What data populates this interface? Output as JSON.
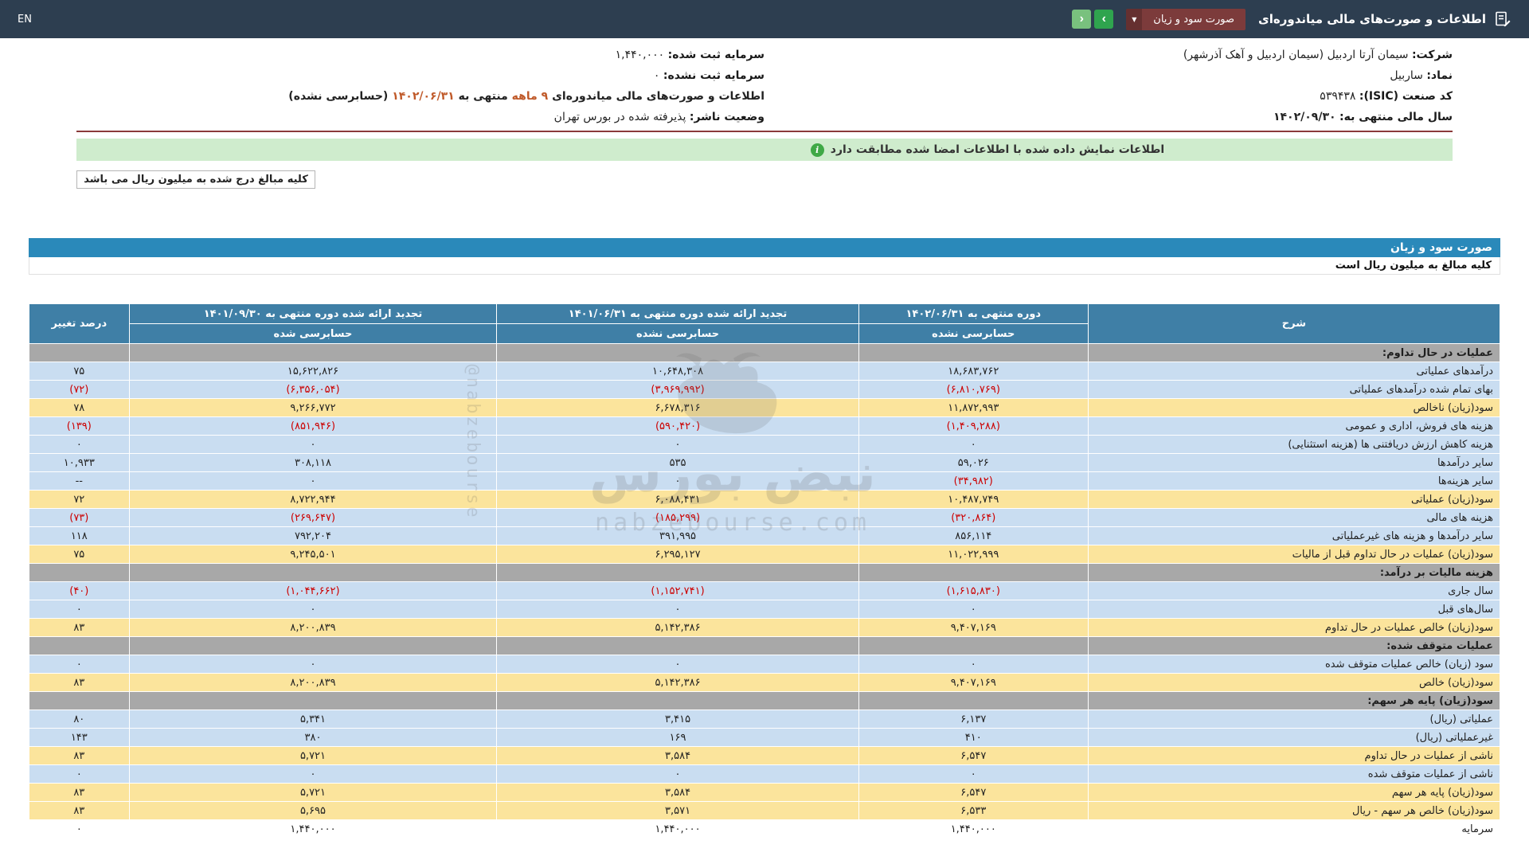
{
  "colors": {
    "topbar": "#2d3e50",
    "dropdown_maroon": "#7c3b3b",
    "nav_green": "#2fa44e",
    "banner_green": "#cfeccd",
    "statement_title_bar": "#2a89ba",
    "table_header": "#3f7fa6",
    "row_blue": "#c9ddf1",
    "row_yellow": "#fbe49c",
    "section_gray": "#a8a8a8",
    "negative_red": "#cc0000",
    "date_highlight": "#c05a2a"
  },
  "topbar": {
    "title": "اطلاعات و صورت‌های مالی میاندوره‌ای",
    "dropdown_value": "صورت سود و زیان",
    "lang_toggle": "EN"
  },
  "company_info": {
    "company_label": "شرکت:",
    "company_value": "سیمان آرتا اردبیل (سیمان اردبیل و آهک آذرشهر)",
    "symbol_label": "نماد:",
    "symbol_value": "ساربیل",
    "isic_label": "کد صنعت (ISIC):",
    "isic_value": "۵۳۹۴۳۸",
    "fiscal_year_label": "سال مالی منتهی به:",
    "fiscal_year_value": "۱۴۰۲/۰۹/۳۰",
    "registered_capital_label": "سرمایه ثبت شده:",
    "registered_capital_value": "۱,۴۴۰,۰۰۰",
    "unregistered_capital_label": "سرمایه ثبت نشده:",
    "unregistered_capital_value": "۰",
    "period_prefix": "اطلاعات و صورت‌های مالی میاندوره‌ای",
    "period_months": "۹ ماهه",
    "period_middle": "منتهی به",
    "period_date": "۱۴۰۲/۰۶/۳۱",
    "period_suffix": "(حسابرسی نشده)",
    "issuer_label": "وضعیت ناشر:",
    "issuer_value": "پذیرفته شده در بورس تهران"
  },
  "notices": {
    "signature_match": "اطلاعات نمایش داده شده با اطلاعات امضا شده مطابقت دارد",
    "amounts_unit_top": "کلیه مبالغ درج شده به میلیون ریال می باشد"
  },
  "statement": {
    "title": "صورت سود و زیان",
    "unit_note": "کلیه مبالغ به میلیون ریال است"
  },
  "table": {
    "headers": {
      "description": "شرح",
      "col1_title": "دوره منتهی به ۱۴۰۲/۰۶/۳۱",
      "col1_sub": "حسابرسی نشده",
      "col2_title": "تجدید ارائه شده دوره منتهی به ۱۴۰۱/۰۶/۳۱",
      "col2_sub": "حسابرسی نشده",
      "col3_title": "تجدید ارائه شده دوره منتهی به ۱۴۰۱/۰۹/۳۰",
      "col3_sub": "حسابرسی شده",
      "pct_change": "درصد تغییر"
    },
    "rows": [
      {
        "style": "section",
        "label": "عملیات در حال تداوم:",
        "c1": "",
        "c2": "",
        "c3": "",
        "pct": ""
      },
      {
        "style": "blue",
        "label": "درآمدهای عملیاتی",
        "c1": "۱۸,۶۸۳,۷۶۲",
        "c2": "۱۰,۶۴۸,۳۰۸",
        "c3": "۱۵,۶۲۲,۸۲۶",
        "pct": "۷۵"
      },
      {
        "style": "blue",
        "label": "بهای تمام شده درآمدهای عملیاتی",
        "c1": "(۶,۸۱۰,۷۶۹)",
        "c2": "(۳,۹۶۹,۹۹۲)",
        "c3": "(۶,۳۵۶,۰۵۴)",
        "pct": "(۷۲)"
      },
      {
        "style": "yellow",
        "label": "سود(زیان) ناخالص",
        "c1": "۱۱,۸۷۲,۹۹۳",
        "c2": "۶,۶۷۸,۳۱۶",
        "c3": "۹,۲۶۶,۷۷۲",
        "pct": "۷۸"
      },
      {
        "style": "blue",
        "label": "هزینه های فروش، اداری و عمومی",
        "c1": "(۱,۴۰۹,۲۸۸)",
        "c2": "(۵۹۰,۴۲۰)",
        "c3": "(۸۵۱,۹۴۶)",
        "pct": "(۱۳۹)"
      },
      {
        "style": "blue",
        "label": "هزینه کاهش ارزش دریافتنی ها (هزینه استثنایی)",
        "c1": "۰",
        "c2": "۰",
        "c3": "۰",
        "pct": "۰"
      },
      {
        "style": "blue",
        "label": "سایر درآمدها",
        "c1": "۵۹,۰۲۶",
        "c2": "۵۳۵",
        "c3": "۳۰۸,۱۱۸",
        "pct": "۱۰,۹۳۳"
      },
      {
        "style": "blue",
        "label": "سایر هزینه‌ها",
        "c1": "(۳۴,۹۸۲)",
        "c2": "۰",
        "c3": "۰",
        "pct": "--"
      },
      {
        "style": "yellow",
        "label": "سود(زیان) عملیاتی",
        "c1": "۱۰,۴۸۷,۷۴۹",
        "c2": "۶,۰۸۸,۴۳۱",
        "c3": "۸,۷۲۲,۹۴۴",
        "pct": "۷۲"
      },
      {
        "style": "blue",
        "label": "هزینه های مالی",
        "c1": "(۳۲۰,۸۶۴)",
        "c2": "(۱۸۵,۲۹۹)",
        "c3": "(۲۶۹,۶۴۷)",
        "pct": "(۷۳)"
      },
      {
        "style": "blue",
        "label": "سایر درآمدها و هزینه های غیرعملیاتی",
        "c1": "۸۵۶,۱۱۴",
        "c2": "۳۹۱,۹۹۵",
        "c3": "۷۹۲,۲۰۴",
        "pct": "۱۱۸"
      },
      {
        "style": "yellow",
        "label": "سود(زیان) عملیات در حال تداوم قبل از مالیات",
        "c1": "۱۱,۰۲۲,۹۹۹",
        "c2": "۶,۲۹۵,۱۲۷",
        "c3": "۹,۲۴۵,۵۰۱",
        "pct": "۷۵"
      },
      {
        "style": "section",
        "label": "هزینه مالیات بر درآمد:",
        "c1": "",
        "c2": "",
        "c3": "",
        "pct": ""
      },
      {
        "style": "blue",
        "label": "سال جاری",
        "c1": "(۱,۶۱۵,۸۳۰)",
        "c2": "(۱,۱۵۲,۷۴۱)",
        "c3": "(۱,۰۴۴,۶۶۲)",
        "pct": "(۴۰)"
      },
      {
        "style": "blue",
        "label": "سال‌های قبل",
        "c1": "۰",
        "c2": "۰",
        "c3": "۰",
        "pct": "۰"
      },
      {
        "style": "yellow",
        "label": "سود(زیان) خالص عملیات در حال تداوم",
        "c1": "۹,۴۰۷,۱۶۹",
        "c2": "۵,۱۴۲,۳۸۶",
        "c3": "۸,۲۰۰,۸۳۹",
        "pct": "۸۳"
      },
      {
        "style": "section",
        "label": "عملیات متوقف شده:",
        "c1": "",
        "c2": "",
        "c3": "",
        "pct": ""
      },
      {
        "style": "blue",
        "label": "سود (زیان) خالص عملیات متوقف شده",
        "c1": "۰",
        "c2": "۰",
        "c3": "۰",
        "pct": "۰"
      },
      {
        "style": "yellow",
        "label": "سود(زیان) خالص",
        "c1": "۹,۴۰۷,۱۶۹",
        "c2": "۵,۱۴۲,۳۸۶",
        "c3": "۸,۲۰۰,۸۳۹",
        "pct": "۸۳"
      },
      {
        "style": "section",
        "label": "سود(زیان) پایه هر سهم:",
        "c1": "",
        "c2": "",
        "c3": "",
        "pct": ""
      },
      {
        "style": "blue",
        "label": "عملیاتی (ریال)",
        "c1": "۶,۱۳۷",
        "c2": "۳,۴۱۵",
        "c3": "۵,۳۴۱",
        "pct": "۸۰"
      },
      {
        "style": "blue",
        "label": "غیرعملیاتی (ریال)",
        "c1": "۴۱۰",
        "c2": "۱۶۹",
        "c3": "۳۸۰",
        "pct": "۱۴۳"
      },
      {
        "style": "yellow",
        "label": "ناشی از عملیات در حال تداوم",
        "c1": "۶,۵۴۷",
        "c2": "۳,۵۸۴",
        "c3": "۵,۷۲۱",
        "pct": "۸۳"
      },
      {
        "style": "blue",
        "label": "ناشی از عملیات متوقف شده",
        "c1": "۰",
        "c2": "۰",
        "c3": "۰",
        "pct": "۰"
      },
      {
        "style": "yellow",
        "label": "سود(زیان) پایه هر سهم",
        "c1": "۶,۵۴۷",
        "c2": "۳,۵۸۴",
        "c3": "۵,۷۲۱",
        "pct": "۸۳"
      },
      {
        "style": "yellow",
        "label": "سود(زیان) خالص هر سهم - ریال",
        "c1": "۶,۵۳۳",
        "c2": "۳,۵۷۱",
        "c3": "۵,۶۹۵",
        "pct": "۸۳"
      },
      {
        "style": "white",
        "label": "سرمایه",
        "c1": "۱,۴۴۰,۰۰۰",
        "c2": "۱,۴۴۰,۰۰۰",
        "c3": "۱,۴۴۰,۰۰۰",
        "pct": "۰"
      }
    ]
  },
  "watermark": {
    "title": "نبض بورس",
    "site": "nabzebourse.com",
    "handle": "@nabzebourse"
  }
}
